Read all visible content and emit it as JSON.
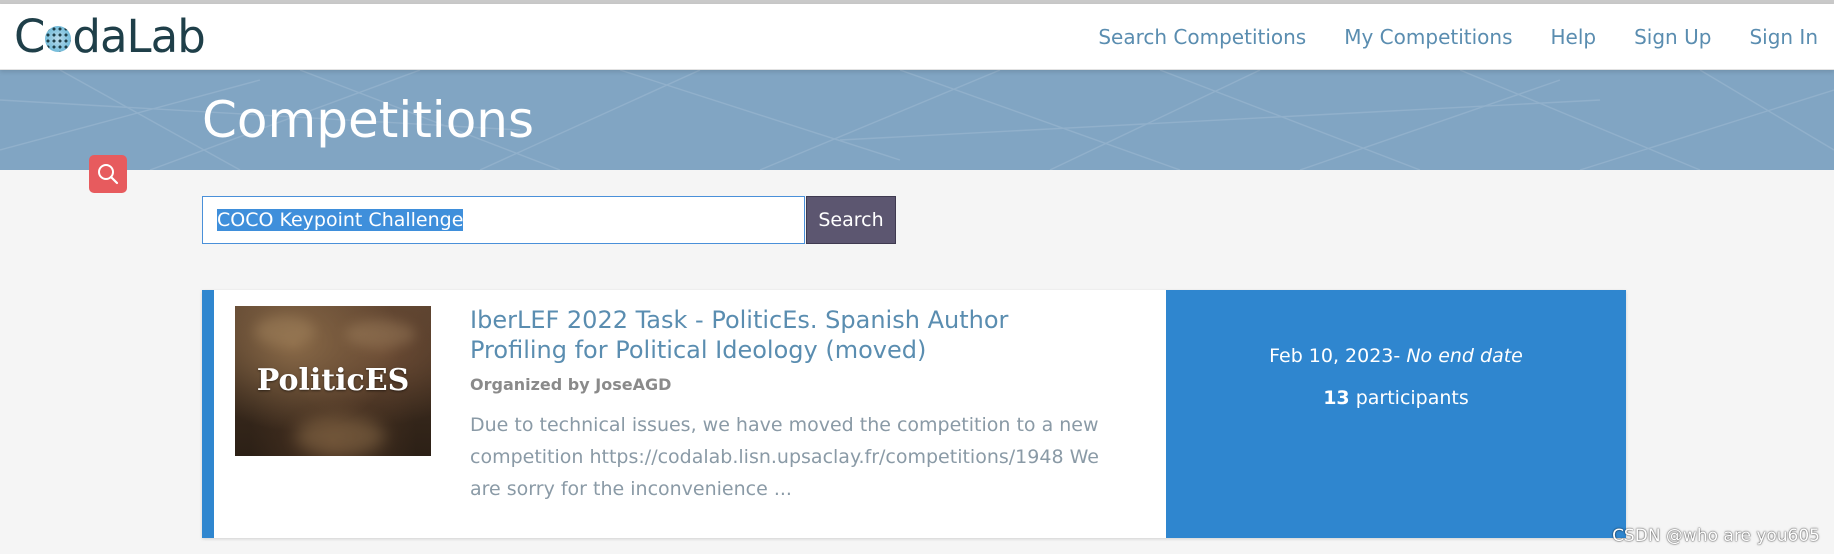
{
  "header": {
    "logo_text_before": "C",
    "logo_text_after": "daLab",
    "nav": [
      "Search Competitions",
      "My Competitions",
      "Help",
      "Sign Up",
      "Sign In"
    ]
  },
  "banner": {
    "title": "Competitions"
  },
  "search": {
    "value": "COCO Keypoint Challenge",
    "button_label": "Search",
    "toggle_icon": "search-icon"
  },
  "competitions": [
    {
      "title": "IberLEF 2022 Task - PoliticEs. Spanish Author Profiling for Political Ideology (moved)",
      "organizer": "Organized by JoseAGD",
      "description": "Due to technical issues, we have moved the competition to a new competition https://codalab.lisn.upsaclay.fr/competitions/1948 We are sorry for the inconvenience ...",
      "thumbnail_text": "PoliticES",
      "start_date": "Feb 10, 2023-",
      "end_date": "No end date",
      "participants_count": "13",
      "participants_label": "participants"
    }
  ],
  "watermark": "CSDN @who are you605",
  "colors": {
    "banner": "#81a5c3",
    "accent": "#2f86cf",
    "search_toggle": "#e75b5e",
    "search_button": "#5c5670",
    "link": "#5a8db0"
  }
}
